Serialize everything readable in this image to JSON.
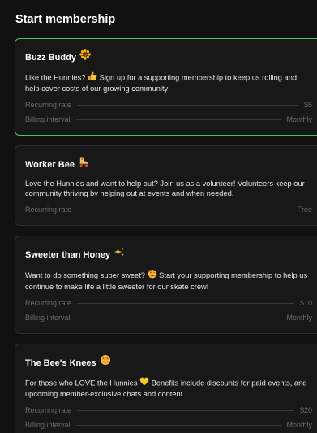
{
  "page": {
    "title": "Start membership"
  },
  "tiers": [
    {
      "title": "Buzz Buddy",
      "desc_before": "Like the Hunnies?",
      "desc_after": "Sign up for a supporting membership to keep us rolling and help cover costs of our growing community!",
      "rate_label": "Recurring rate",
      "rate_value": "$5",
      "interval_label": "Billing interval",
      "interval_value": "Monthly",
      "title_icon": "sunflower-icon",
      "desc_icon": "thumbs-up-icon"
    },
    {
      "title": "Worker Bee",
      "desc": "Love the Hunnies and want to help out? Join us as a volunteer! Volunteers keep our community thriving by helping out at events and when needed.",
      "rate_label": "Recurring rate",
      "rate_value": "Free",
      "title_icon": "roller-skate-icon"
    },
    {
      "title": "Sweeter than Honey",
      "desc_before": "Want to do something super sweet?",
      "desc_after": "Start your supporting membership to help us continue to make life a little sweeter for our skate crew!",
      "rate_label": "Recurring rate",
      "rate_value": "$10",
      "interval_label": "Billing interval",
      "interval_value": "Monthly",
      "title_icon": "sparkles-icon",
      "desc_icon": "smiling-face-with-hearts-icon"
    },
    {
      "title": "The Bee's Knees",
      "desc_before": "For those who LOVE the Hunnies",
      "desc_after": "Benefits include discounts for paid events, and upcoming member-exclusive chats and content.",
      "rate_label": "Recurring rate",
      "rate_value": "$20",
      "interval_label": "Billing interval",
      "interval_value": "Monthly",
      "title_icon": "star-struck-face-icon",
      "desc_icon": "yellow-heart-icon"
    }
  ],
  "colors": {
    "background": "#111111",
    "card": "#181818",
    "card_border": "#2e2e2e",
    "selected_border": "#4cc07c",
    "muted_text": "#6e6e6e"
  }
}
